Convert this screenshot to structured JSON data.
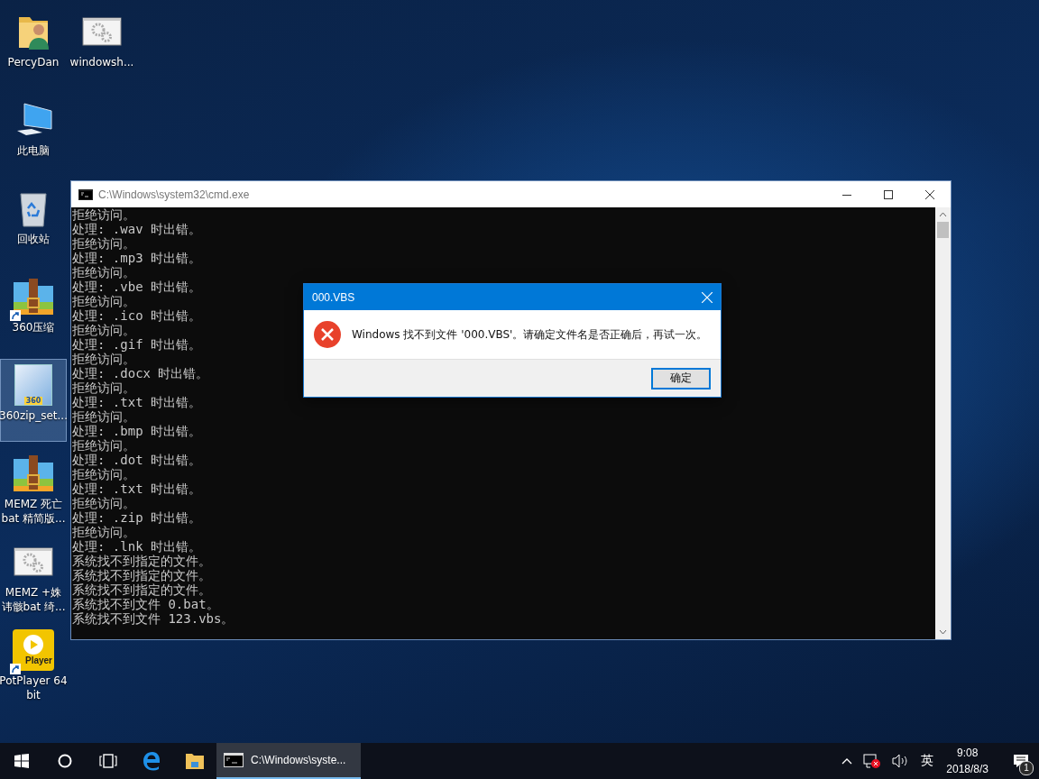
{
  "desktop_icons": [
    {
      "kind": "user-folder",
      "lines": [
        "PercyDan"
      ],
      "selected": false,
      "shortcut": false
    },
    {
      "kind": "gear-window",
      "lines": [
        "windowsh..."
      ],
      "selected": false,
      "shortcut": false
    },
    {
      "kind": "computer",
      "lines": [
        "此电脑"
      ],
      "selected": false,
      "shortcut": false
    },
    {
      "kind": "recycle-bin",
      "lines": [
        "回收站"
      ],
      "selected": false,
      "shortcut": false
    },
    {
      "kind": "archive",
      "lines": [
        "360压缩"
      ],
      "selected": false,
      "shortcut": true
    },
    {
      "kind": "installer",
      "lines": [
        "360zip_set..."
      ],
      "selected": true,
      "shortcut": false,
      "icon_text": "360"
    },
    {
      "kind": "archive",
      "lines": [
        "MEMZ  死亡",
        "bat 精简版..."
      ],
      "selected": false,
      "shortcut": false
    },
    {
      "kind": "gear-window",
      "lines": [
        "MEMZ +姝",
        "讳骸bat 绮..."
      ],
      "selected": false,
      "shortcut": false
    },
    {
      "kind": "player",
      "lines": [
        "PotPlayer 64",
        "bit"
      ],
      "selected": false,
      "shortcut": true,
      "icon_text": "Player"
    }
  ],
  "console_window": {
    "title": "C:\\Windows\\system32\\cmd.exe",
    "lines": [
      "拒绝访问。",
      "处理: .wav 时出错。",
      "拒绝访问。",
      "处理: .mp3 时出错。",
      "拒绝访问。",
      "处理: .vbe 时出错。",
      "拒绝访问。",
      "处理: .ico 时出错。",
      "拒绝访问。",
      "处理: .gif 时出错。",
      "拒绝访问。",
      "处理: .docx 时出错。",
      "拒绝访问。",
      "处理: .txt 时出错。",
      "拒绝访问。",
      "处理: .bmp 时出错。",
      "拒绝访问。",
      "处理: .dot 时出错。",
      "拒绝访问。",
      "处理: .txt 时出错。",
      "拒绝访问。",
      "处理: .zip 时出错。",
      "拒绝访问。",
      "处理: .lnk 时出错。",
      "系统找不到指定的文件。",
      "系统找不到指定的文件。",
      "系统找不到指定的文件。",
      "系统找不到文件 0.bat。",
      "系统找不到文件 123.vbs。"
    ]
  },
  "dialog": {
    "title": "000.VBS",
    "message": "Windows 找不到文件 '000.VBS'。请确定文件名是否正确后，再试一次。",
    "button": "确定"
  },
  "taskbar": {
    "task_title": "C:\\Windows\\syste...",
    "input_language": "英",
    "time": "9:08",
    "date": "2018/8/3",
    "notification_count": "1"
  }
}
